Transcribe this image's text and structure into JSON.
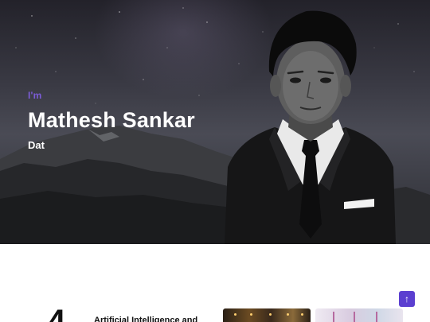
{
  "hero": {
    "intro": "I'm",
    "name": "Mathesh Sankar",
    "role": "Dat"
  },
  "section": {
    "big_number": "4",
    "course_title": "Artificial Intelligence and"
  },
  "scroll_top_icon": "arrow-up-icon",
  "colors": {
    "accent": "#7b5cd6",
    "button": "#5b3fd0"
  }
}
